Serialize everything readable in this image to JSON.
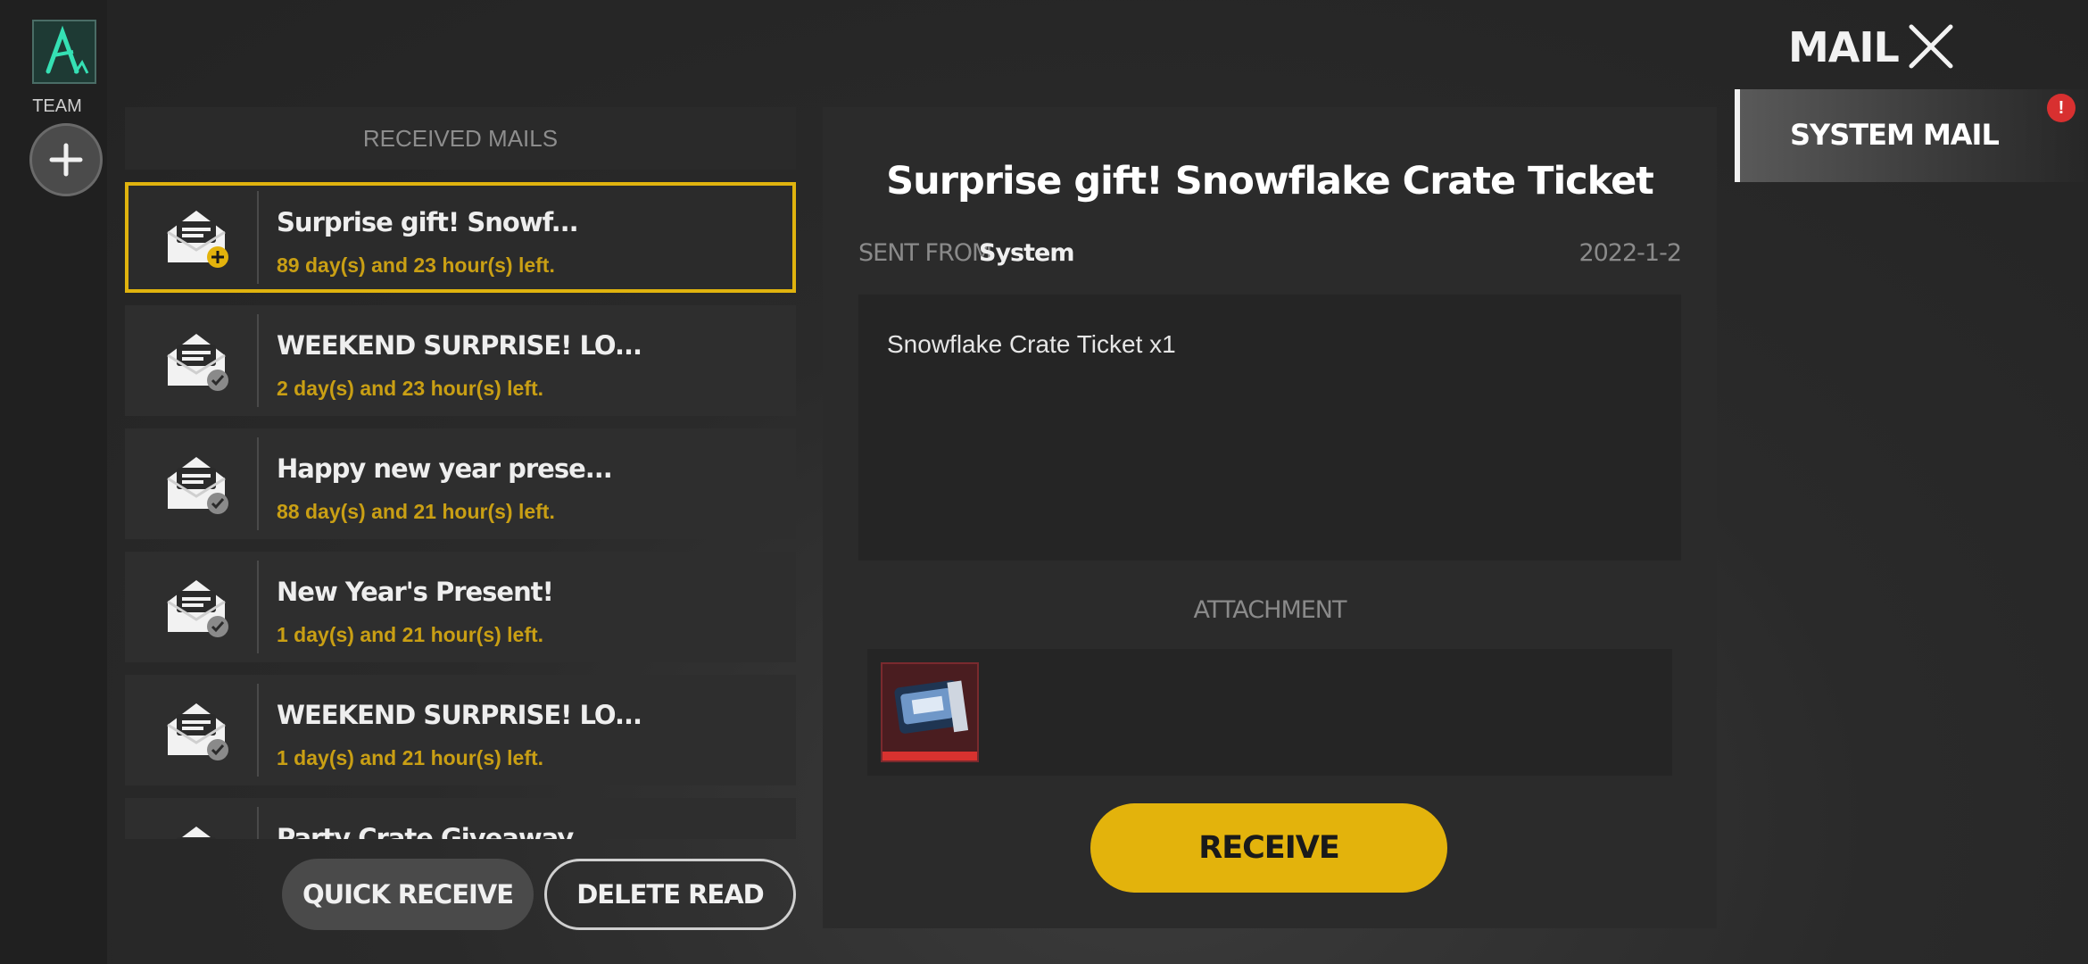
{
  "left_rail": {
    "team_label": "TEAM",
    "avatar_icon": "team-logo-icon",
    "add_icon": "plus-icon"
  },
  "list": {
    "header": "RECEIVED MAILS",
    "items": [
      {
        "title": "Surprise gift! Snowf...",
        "time_left": "89 day(s) and 23 hour(s) left.",
        "status": "unclaimed",
        "selected": true
      },
      {
        "title": "WEEKEND SURPRISE! LO...",
        "time_left": "2 day(s) and 23 hour(s) left.",
        "status": "read"
      },
      {
        "title": "Happy new year prese...",
        "time_left": "88 day(s) and 21 hour(s) left.",
        "status": "read"
      },
      {
        "title": "New Year's Present!",
        "time_left": "1 day(s) and 21 hour(s) left.",
        "status": "read"
      },
      {
        "title": "WEEKEND SURPRISE! LO...",
        "time_left": "1 day(s) and 21 hour(s) left.",
        "status": "read"
      },
      {
        "title": "Party Crate Giveaway",
        "time_left": "",
        "status": "read"
      }
    ],
    "quick_receive": "QUICK RECEIVE",
    "delete_read": "DELETE READ"
  },
  "detail": {
    "title": "Surprise gift! Snowflake Crate Ticket",
    "sent_from_label": "SENT FROM",
    "sender": "System",
    "date": "2022-1-2",
    "body": "Snowflake Crate Ticket x1",
    "attachment_label": "ATTACHMENT",
    "attachment_icon": "snowflake-crate-ticket-icon",
    "receive": "RECEIVE"
  },
  "right": {
    "heading": "MAIL",
    "tab_label": "SYSTEM MAIL",
    "badge": "!",
    "colors": {
      "accent": "#e3b30c",
      "badge": "#d83030"
    }
  }
}
